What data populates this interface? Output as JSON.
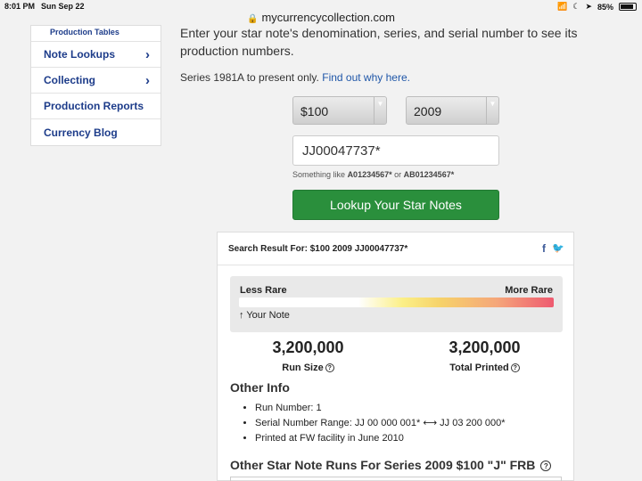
{
  "status": {
    "time": "8:01 PM",
    "date": "Sun Sep 22",
    "battery": "85%",
    "battery_fraction": 0.85
  },
  "browser": {
    "url": "mycurrencycollection.com"
  },
  "sidebar": {
    "sub_label": "Production Tables",
    "items": [
      {
        "label": "Note Lookups",
        "has_chevron": true
      },
      {
        "label": "Collecting",
        "has_chevron": true
      },
      {
        "label": "Production Reports",
        "has_chevron": false
      },
      {
        "label": "Currency Blog",
        "has_chevron": false
      }
    ]
  },
  "main": {
    "intro": "Enter your star note's denomination, series, and serial number to see its production numbers.",
    "series_note": "Series 1981A to present only.",
    "series_link": "Find out why here.",
    "denomination": "$100",
    "series": "2009",
    "serial_value": "JJ00047737*",
    "hint_prefix": "Something like",
    "hint_ex1": "A01234567*",
    "hint_or": "or",
    "hint_ex2": "AB01234567*",
    "lookup_label": "Lookup Your Star Notes"
  },
  "result": {
    "heading": "Search Result For: $100 2009 JJ00047737*",
    "rarity": {
      "less_label": "Less Rare",
      "more_label": "More Rare",
      "marker_label": "Your Note"
    },
    "run_size": "3,200,000",
    "run_size_label": "Run Size",
    "total_printed": "3,200,000",
    "total_printed_label": "Total Printed",
    "other_info_title": "Other Info",
    "info": [
      "Run Number: 1",
      "Serial Number Range: JJ 00 000 001* ⟷ JJ 03 200 000*",
      "Printed at FW facility in June 2010"
    ],
    "other_runs_title": "Other Star Note Runs For Series 2009 $100 \"J\" FRB"
  },
  "colors": {
    "link": "#1f56a8",
    "nav": "#1d3c8a",
    "button": "#2a8f3c"
  }
}
